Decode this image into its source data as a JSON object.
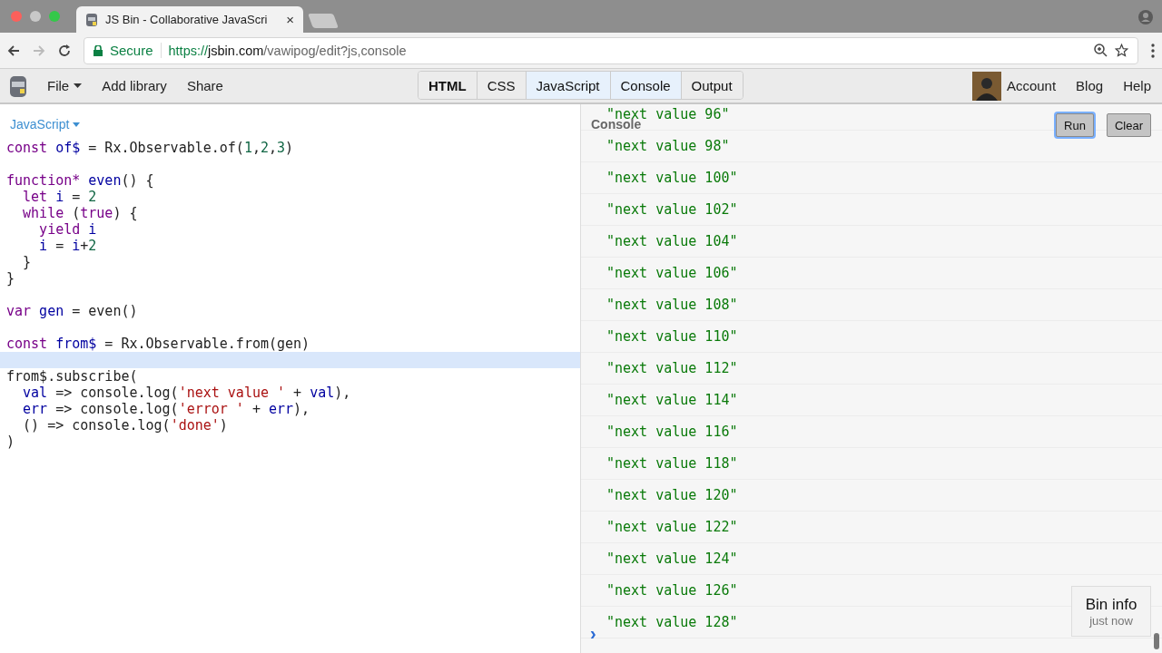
{
  "browser": {
    "tab_title": "JS Bin - Collaborative JavaScri",
    "tab_close": "×",
    "secure_label": "Secure",
    "url_scheme": "https://",
    "url_host": "jsbin.com",
    "url_path": "/vawipog/edit?js,console"
  },
  "toolbar": {
    "menus": [
      {
        "label": "File",
        "dropdown": true
      },
      {
        "label": "Add library",
        "dropdown": false
      },
      {
        "label": "Share",
        "dropdown": false
      }
    ],
    "panels": [
      {
        "label": "HTML",
        "selected": false,
        "bold": true
      },
      {
        "label": "CSS",
        "selected": false,
        "bold": false
      },
      {
        "label": "JavaScript",
        "selected": true,
        "bold": false
      },
      {
        "label": "Console",
        "selected": true,
        "bold": false
      },
      {
        "label": "Output",
        "selected": false,
        "bold": false
      }
    ],
    "account": "Account",
    "links": [
      "Blog",
      "Help"
    ]
  },
  "editor": {
    "language": "JavaScript",
    "lines": [
      {
        "kind": "code",
        "tokens": [
          {
            "kind": "keyword",
            "text": "const"
          },
          {
            "kind": "def",
            "text": " of$"
          },
          {
            "kind": "plain",
            "text": " = Rx.Observable.of("
          },
          {
            "kind": "number",
            "text": "1"
          },
          {
            "kind": "plain",
            "text": ","
          },
          {
            "kind": "number",
            "text": "2"
          },
          {
            "kind": "plain",
            "text": ","
          },
          {
            "kind": "number",
            "text": "3"
          },
          {
            "kind": "plain",
            "text": ")"
          }
        ]
      },
      {
        "kind": "blank"
      },
      {
        "kind": "code",
        "tokens": [
          {
            "kind": "keyword",
            "text": "function*"
          },
          {
            "kind": "def",
            "text": " even"
          },
          {
            "kind": "plain",
            "text": "() {"
          }
        ]
      },
      {
        "kind": "code",
        "tokens": [
          {
            "kind": "keyword",
            "text": "  let"
          },
          {
            "kind": "def",
            "text": " i"
          },
          {
            "kind": "plain",
            "text": " = "
          },
          {
            "kind": "number",
            "text": "2"
          }
        ]
      },
      {
        "kind": "code",
        "tokens": [
          {
            "kind": "keyword",
            "text": "  while"
          },
          {
            "kind": "plain",
            "text": " ("
          },
          {
            "kind": "keyword",
            "text": "true"
          },
          {
            "kind": "plain",
            "text": ") {"
          }
        ]
      },
      {
        "kind": "code",
        "tokens": [
          {
            "kind": "keyword",
            "text": "    yield"
          },
          {
            "kind": "def",
            "text": " i"
          }
        ]
      },
      {
        "kind": "code",
        "tokens": [
          {
            "kind": "def",
            "text": "    i"
          },
          {
            "kind": "plain",
            "text": " = "
          },
          {
            "kind": "def",
            "text": "i"
          },
          {
            "kind": "plain",
            "text": "+"
          },
          {
            "kind": "number",
            "text": "2"
          }
        ]
      },
      {
        "kind": "code",
        "tokens": [
          {
            "kind": "plain",
            "text": "  }"
          }
        ]
      },
      {
        "kind": "code",
        "tokens": [
          {
            "kind": "plain",
            "text": "}"
          }
        ]
      },
      {
        "kind": "blank"
      },
      {
        "kind": "code",
        "tokens": [
          {
            "kind": "keyword",
            "text": "var"
          },
          {
            "kind": "def",
            "text": " gen"
          },
          {
            "kind": "plain",
            "text": " = even()"
          }
        ]
      },
      {
        "kind": "blank"
      },
      {
        "kind": "code",
        "tokens": [
          {
            "kind": "keyword",
            "text": "const"
          },
          {
            "kind": "def",
            "text": " from$"
          },
          {
            "kind": "plain",
            "text": " = Rx.Observable.from(gen)"
          }
        ]
      },
      {
        "kind": "cursor"
      },
      {
        "kind": "code",
        "tokens": [
          {
            "kind": "plain",
            "text": "from$.subscribe("
          }
        ]
      },
      {
        "kind": "code",
        "tokens": [
          {
            "kind": "def",
            "text": "  val"
          },
          {
            "kind": "plain",
            "text": " => console.log("
          },
          {
            "kind": "string",
            "text": "'next value '"
          },
          {
            "kind": "plain",
            "text": " + "
          },
          {
            "kind": "def",
            "text": "val"
          },
          {
            "kind": "plain",
            "text": "),"
          }
        ]
      },
      {
        "kind": "code",
        "tokens": [
          {
            "kind": "def",
            "text": "  err"
          },
          {
            "kind": "plain",
            "text": " => console.log("
          },
          {
            "kind": "string",
            "text": "'error '"
          },
          {
            "kind": "plain",
            "text": " + "
          },
          {
            "kind": "def",
            "text": "err"
          },
          {
            "kind": "plain",
            "text": "),"
          }
        ]
      },
      {
        "kind": "code",
        "tokens": [
          {
            "kind": "plain",
            "text": "  () => console.log("
          },
          {
            "kind": "string",
            "text": "'done'"
          },
          {
            "kind": "plain",
            "text": ")"
          }
        ]
      },
      {
        "kind": "code",
        "tokens": [
          {
            "kind": "plain",
            "text": ")"
          }
        ]
      }
    ]
  },
  "console": {
    "title": "Console",
    "buttons": [
      {
        "label": "Run",
        "focused": true
      },
      {
        "label": "Clear",
        "focused": false
      }
    ],
    "entries": [
      "\"next value 96\"",
      "\"next value 98\"",
      "\"next value 100\"",
      "\"next value 102\"",
      "\"next value 104\"",
      "\"next value 106\"",
      "\"next value 108\"",
      "\"next value 110\"",
      "\"next value 112\"",
      "\"next value 114\"",
      "\"next value 116\"",
      "\"next value 118\"",
      "\"next value 120\"",
      "\"next value 122\"",
      "\"next value 124\"",
      "\"next value 126\"",
      "\"next value 128\""
    ],
    "prompt": "›"
  },
  "bin_info": {
    "title": "Bin info",
    "time": "just now"
  }
}
